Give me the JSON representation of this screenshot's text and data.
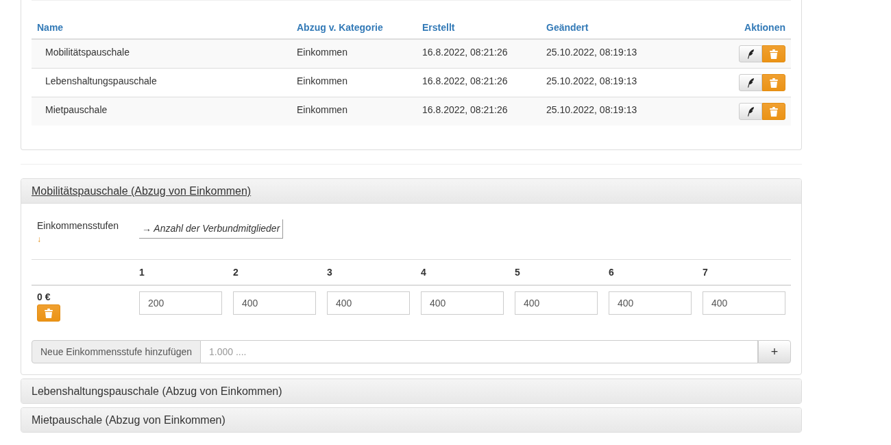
{
  "table": {
    "columns": [
      "Name",
      "Abzug v. Kategorie",
      "Erstellt",
      "Geändert",
      "Aktionen"
    ],
    "rows": [
      {
        "name": "Mobilitätspauschale",
        "category": "Einkommen",
        "created": "16.8.2022, 08:21:26",
        "changed": "25.10.2022, 08:19:13"
      },
      {
        "name": "Lebenshaltungspauschale",
        "category": "Einkommen",
        "created": "16.8.2022, 08:21:26",
        "changed": "25.10.2022, 08:19:13"
      },
      {
        "name": "Mietpauschale",
        "category": "Einkommen",
        "created": "16.8.2022, 08:21:26",
        "changed": "25.10.2022, 08:19:13"
      }
    ]
  },
  "sections": [
    {
      "title": "Mobilitätspauschale (Abzug von Einkommen)",
      "expanded": true,
      "row_axis_label": "Einkommensstufen",
      "row_axis_arrow": "↓",
      "column_axis_label": "→ Anzahl der Verbundmitglieder",
      "member_counts": [
        "1",
        "2",
        "3",
        "4",
        "5",
        "6",
        "7"
      ],
      "tiers": [
        {
          "income": "0 €",
          "values": [
            "200",
            "400",
            "400",
            "400",
            "400",
            "400",
            "400"
          ]
        }
      ],
      "add_tier": {
        "label": "Neue Einkommensstufe hinzufügen",
        "placeholder": "1.000 ....",
        "button": "+"
      }
    },
    {
      "title": "Lebenshaltungspauschale (Abzug von Einkommen)",
      "expanded": false
    },
    {
      "title": "Mietpauschale (Abzug von Einkommen)",
      "expanded": false
    }
  ]
}
